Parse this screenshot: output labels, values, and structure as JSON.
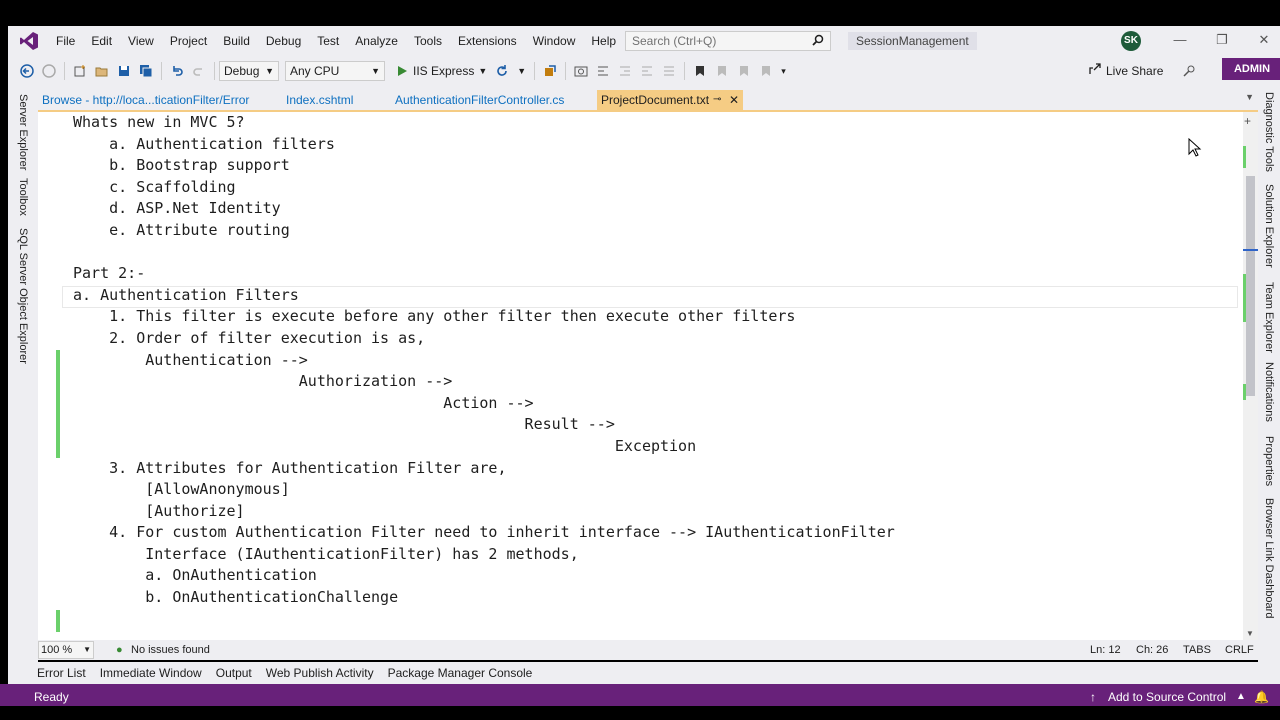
{
  "menu": {
    "items": [
      "File",
      "Edit",
      "View",
      "Project",
      "Build",
      "Debug",
      "Test",
      "Analyze",
      "Tools",
      "Extensions",
      "Window",
      "Help"
    ],
    "search_placeholder": "Search (Ctrl+Q)",
    "solution": "SessionManagement",
    "avatar": "SK"
  },
  "toolbar": {
    "config": "Debug",
    "platform": "Any CPU",
    "run_target": "IIS Express",
    "live_share": "Live Share",
    "admin": "ADMIN"
  },
  "left_tabs": [
    "Server Explorer",
    "Toolbox",
    "SQL Server Object Explorer"
  ],
  "right_tabs": [
    "Diagnostic Tools",
    "Solution Explorer",
    "Team Explorer",
    "Notifications",
    "Properties",
    "Browser Link Dashboard"
  ],
  "doc_tabs": [
    {
      "label": "Browse - http://loca...ticationFilter/Error"
    },
    {
      "label": "Index.cshtml"
    },
    {
      "label": "AuthenticationFilterController.cs"
    },
    {
      "label": "ProjectDocument.txt"
    }
  ],
  "code_lines": [
    "Whats new in MVC 5?",
    "    a. Authentication filters",
    "    b. Bootstrap support",
    "    c. Scaffolding",
    "    d. ASP.Net Identity",
    "    e. Attribute routing",
    "",
    "Part 2:-",
    "a. Authentication Filters",
    "    1. This filter is execute before any other filter then execute other filters",
    "    2. Order of filter execution is as,",
    "        Authentication -->",
    "                         Authorization -->",
    "                                         Action -->",
    "                                                  Result -->",
    "                                                            Exception",
    "    3. Attributes for Authentication Filter are,",
    "        [AllowAnonymous]",
    "        [Authorize]",
    "    4. For custom Authentication Filter need to inherit interface --> IAuthenticationFilter",
    "        Interface (IAuthenticationFilter) has 2 methods,",
    "        a. OnAuthentication",
    "        b. OnAuthenticationChallenge"
  ],
  "status": {
    "zoom": "100 %",
    "issues": "No issues found",
    "line": "Ln: 12",
    "col": "Ch: 26",
    "tabs": "TABS",
    "eol": "CRLF"
  },
  "bottom_tabs": [
    "Error List",
    "Immediate Window",
    "Output",
    "Web Publish Activity",
    "Package Manager Console"
  ],
  "ready": "Ready",
  "source_control": "Add to Source Control",
  "colors": {
    "accent": "#68217a",
    "tab_active": "#f5cc84",
    "change_bar": "#6bd06b"
  }
}
